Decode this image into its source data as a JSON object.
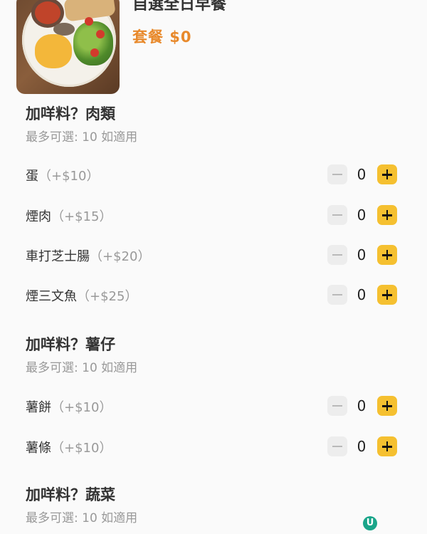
{
  "header": {
    "title": "自選全日早餐",
    "price": "套餐 $0"
  },
  "sections": [
    {
      "title": "加咩料？肉類",
      "subtitle": "最多可選: 10  如適用",
      "options": [
        {
          "name": "蛋",
          "price": "（+$10）",
          "qty": "0"
        },
        {
          "name": "煙肉",
          "price": "（+$15）",
          "qty": "0"
        },
        {
          "name": "車打芝士腸",
          "price": "（+$20）",
          "qty": "0"
        },
        {
          "name": "煙三文魚",
          "price": "（+$25）",
          "qty": "0"
        }
      ]
    },
    {
      "title": "加咩料？薯仔",
      "subtitle": "最多可選: 10  如適用",
      "options": [
        {
          "name": "薯餅",
          "price": "（+$10）",
          "qty": "0"
        },
        {
          "name": "薯條",
          "price": "（+$10）",
          "qty": "0"
        }
      ]
    },
    {
      "title": "加咩料？蔬菜",
      "subtitle": "最多可選: 10  如適用",
      "options": []
    }
  ],
  "colors": {
    "accent_price": "#e8892b",
    "plus_button": "#f5c030",
    "minus_button": "#ededed"
  },
  "icons": {
    "minus": "minus-icon",
    "plus": "plus-icon"
  }
}
